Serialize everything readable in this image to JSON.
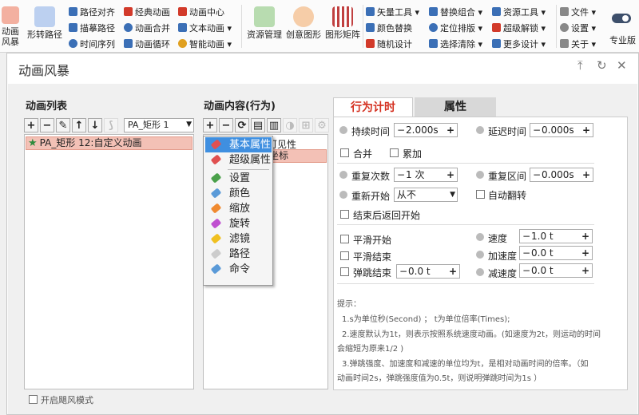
{
  "ribbon": {
    "big": [
      {
        "label": "动画\n风暴",
        "icon": "star-storm-icon",
        "color": "#e8442e"
      },
      {
        "label": "形转路径",
        "icon": "shape-path-icon",
        "color": "#5a88cf"
      },
      {
        "label": "资源管理",
        "icon": "resource-grid-icon",
        "color": "#4a9a4a"
      },
      {
        "label": "创意图形",
        "icon": "creative-shape-icon",
        "color": "#e07a2c"
      },
      {
        "label": "图形矩阵",
        "icon": "matrix-icon",
        "color": "#c04040"
      },
      {
        "label": "专业版",
        "icon": "pro-toggle-icon",
        "color": "#3d4f6b"
      }
    ],
    "small": [
      {
        "label": "路径对齐",
        "color": "#3b6fb6"
      },
      {
        "label": "描摹路径",
        "color": "#3b6fb6"
      },
      {
        "label": "时间序列",
        "color": "#3b6fb6"
      },
      {
        "label": "经典动画",
        "color": "#d23a2a"
      },
      {
        "label": "动画合并",
        "color": "#3b6fb6"
      },
      {
        "label": "动画循环",
        "color": "#3b6fb6"
      },
      {
        "label": "动画中心",
        "color": "#d23a2a"
      },
      {
        "label": "文本动画 ▾",
        "color": "#3b6fb6"
      },
      {
        "label": "智能动画 ▾",
        "color": "#e0a020"
      },
      {
        "label": "矢量工具 ▾",
        "color": "#3b6fb6"
      },
      {
        "label": "颜色替换",
        "color": "#3b6fb6"
      },
      {
        "label": "随机设计",
        "color": "#d23a2a"
      },
      {
        "label": "替换组合 ▾",
        "color": "#3b6fb6"
      },
      {
        "label": "定位排版 ▾",
        "color": "#3b6fb6"
      },
      {
        "label": "选择清除 ▾",
        "color": "#3b6fb6"
      },
      {
        "label": "资源工具 ▾",
        "color": "#3b6fb6"
      },
      {
        "label": "超级解锁 ▾",
        "color": "#d23a2a"
      },
      {
        "label": "更多设计 ▾",
        "color": "#3b6fb6"
      },
      {
        "label": "文件 ▾",
        "color": "#888888"
      },
      {
        "label": "设置 ▾",
        "color": "#888888"
      },
      {
        "label": "关于 ▾",
        "color": "#888888"
      }
    ]
  },
  "dialog": {
    "title": "动画风暴",
    "buttons": [
      "pin",
      "refresh",
      "close"
    ]
  },
  "left_panel": {
    "title": "动画列表",
    "select_value": "PA_矩形 1",
    "items": [
      "PA_矩形 12:自定义动画"
    ]
  },
  "mid_panel": {
    "title": "动画内容(行为)",
    "items": [
      "可见性",
      "坐标"
    ]
  },
  "context_menu": {
    "items": [
      {
        "label": "基本属性",
        "color": "#e05050",
        "highlight": true
      },
      {
        "label": "超级属性",
        "color": "#e05050",
        "highlight": false
      },
      {
        "label": "设置",
        "color": "#4aa04a",
        "highlight": false
      },
      {
        "label": "颜色",
        "color": "#5a9ad8",
        "highlight": false
      },
      {
        "label": "缩放",
        "color": "#f08a30",
        "highlight": false
      },
      {
        "label": "旋转",
        "color": "#c050d0",
        "highlight": false
      },
      {
        "label": "滤镜",
        "color": "#f0c020",
        "highlight": false
      },
      {
        "label": "路径",
        "color": "#cccccc",
        "highlight": false
      },
      {
        "label": "命令",
        "color": "#5a9ad8",
        "highlight": false
      }
    ]
  },
  "tabs": [
    "行为计时",
    "属性"
  ],
  "timing": {
    "duration_label": "持续时间",
    "duration_value": "2.000s",
    "delay_label": "延迟时间",
    "delay_value": "0.000s",
    "merge_label": "合并",
    "stack_label": "累加",
    "repeat_count_label": "重复次数",
    "repeat_count_value": "1 次",
    "repeat_interval_label": "重复区间",
    "repeat_interval_value": "0.000s",
    "restart_label": "重新开始",
    "restart_value": "从不",
    "auto_reverse_label": "自动翻转",
    "return_start_label": "结束后返回开始",
    "smooth_start_label": "平滑开始",
    "smooth_end_label": "平滑结束",
    "bounce_end_label": "弹跳结束",
    "bounce_value": "0.0 t",
    "speed_label": "速度",
    "speed_value": "1.0 t",
    "accel_label": "加速度",
    "accel_value": "0.0 t",
    "decel_label": "减速度",
    "decel_value": "0.0 t"
  },
  "hints": [
    "提示：",
    "1.s为单位秒(Second) ； t为单位倍率(Times);",
    "2.速度默认为1t，则表示按照系统速度动画。(如速度为2t，则运动的时间",
    "会缩短为原来1/2 )",
    "3.弹跳强度、加速度和减速的单位均为t，是相对动画时间的倍率。（如",
    "动画时间2s，弹跳强度值为0.5t，则说明弹跳时间为1s ）"
  ],
  "bottom_option": "开启飓风模式"
}
